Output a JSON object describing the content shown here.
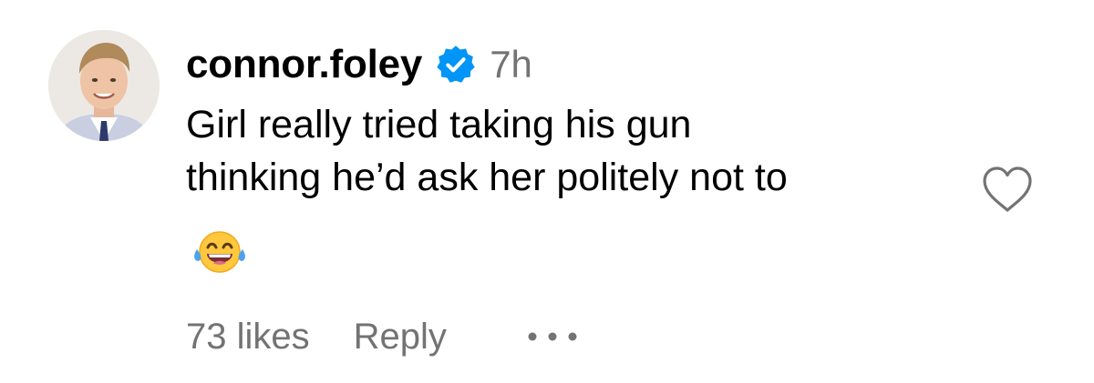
{
  "comment": {
    "username": "connor.foley",
    "verified_icon": "verified-badge-icon",
    "timestamp": "7h",
    "text_lines": [
      "Girl really tried taking his gun",
      "thinking he’d ask her politely not to"
    ],
    "emoji": "face-with-tears-of-joy",
    "like_icon": "heart-outline-icon",
    "likes_label": "73 likes",
    "reply_label": "Reply",
    "more_icon": "more-options-icon"
  },
  "colors": {
    "text_primary": "#000000",
    "text_secondary": "#737373",
    "verified_blue": "#0095F6"
  }
}
